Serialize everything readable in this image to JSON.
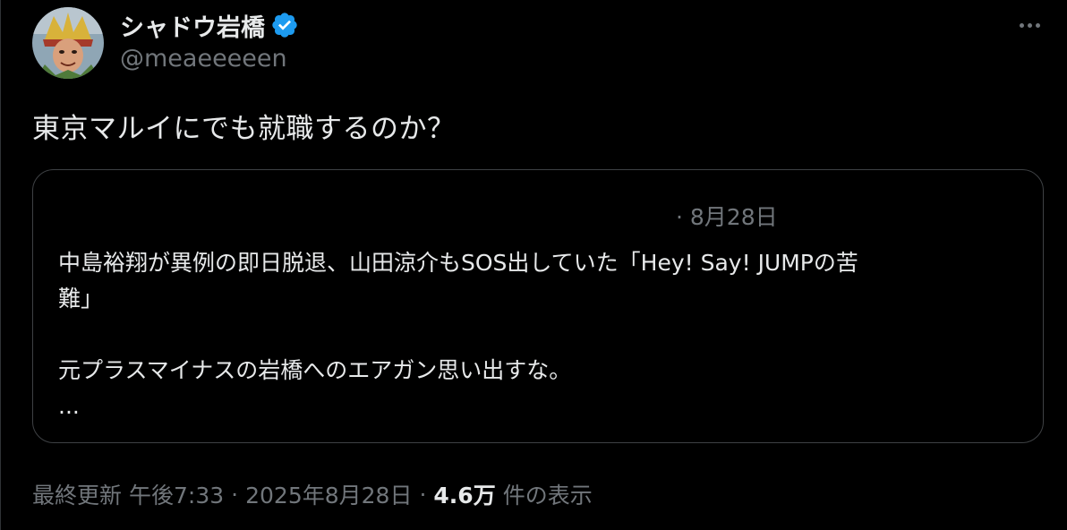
{
  "author": {
    "display_name": "シャドウ岩橋",
    "handle": "@meaeeeeen",
    "verified": true,
    "verified_color": "#1d9bf0"
  },
  "tweet": {
    "text": "東京マルイにでも就職するのか？"
  },
  "quote": {
    "date": "· 8月28日",
    "line1": "中島裕翔が異例の即日脱退、山田涼介もSOS出していた「Hey! Say! JUMPの苦",
    "line2": "難」",
    "line3": "元プラスマイナスの岩橋へのエアガン思い出すな。",
    "line4": "..."
  },
  "meta": {
    "last_updated": "最終更新",
    "time": "午後7:33",
    "date": "2025年8月28日",
    "views_count": "4.6万",
    "views_label": "件の表示"
  },
  "icons": {
    "more": "more-horizontal-icon",
    "verified": "verified-badge-icon"
  },
  "colors": {
    "background": "#000000",
    "text_primary": "#e7e9ea",
    "text_secondary": "#71767b",
    "border": "#3e4144"
  }
}
